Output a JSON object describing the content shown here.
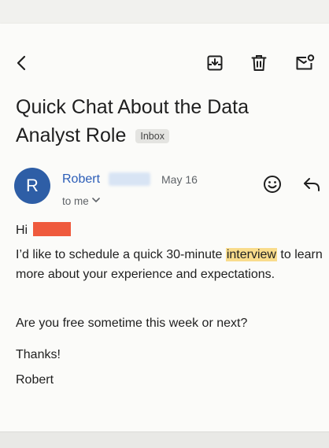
{
  "toolbar": {
    "back_icon": "arrow-back-icon",
    "archive_icon": "archive-icon",
    "delete_icon": "trash-icon",
    "unread_icon": "mark-unread-icon"
  },
  "email": {
    "subject": "Quick Chat About the Data Analyst Role",
    "label": "Inbox",
    "sender": {
      "initial": "R",
      "name": "Robert",
      "avatar_color": "#2e5ea6"
    },
    "date": "May 16",
    "recipients": "to me",
    "body": {
      "greeting": "Hi",
      "para1_before": "I’d like to schedule a quick 30-minute ",
      "para1_highlight": "interview",
      "para1_after": " to learn more about your experience and expectations.",
      "para2": "Are you free sometime this week or next?",
      "closing": "Thanks!",
      "signature": "Robert"
    }
  },
  "colors": {
    "accent": "#2b5db7",
    "highlight": "#f9dc8c",
    "redaction": "#ef5a3d"
  }
}
